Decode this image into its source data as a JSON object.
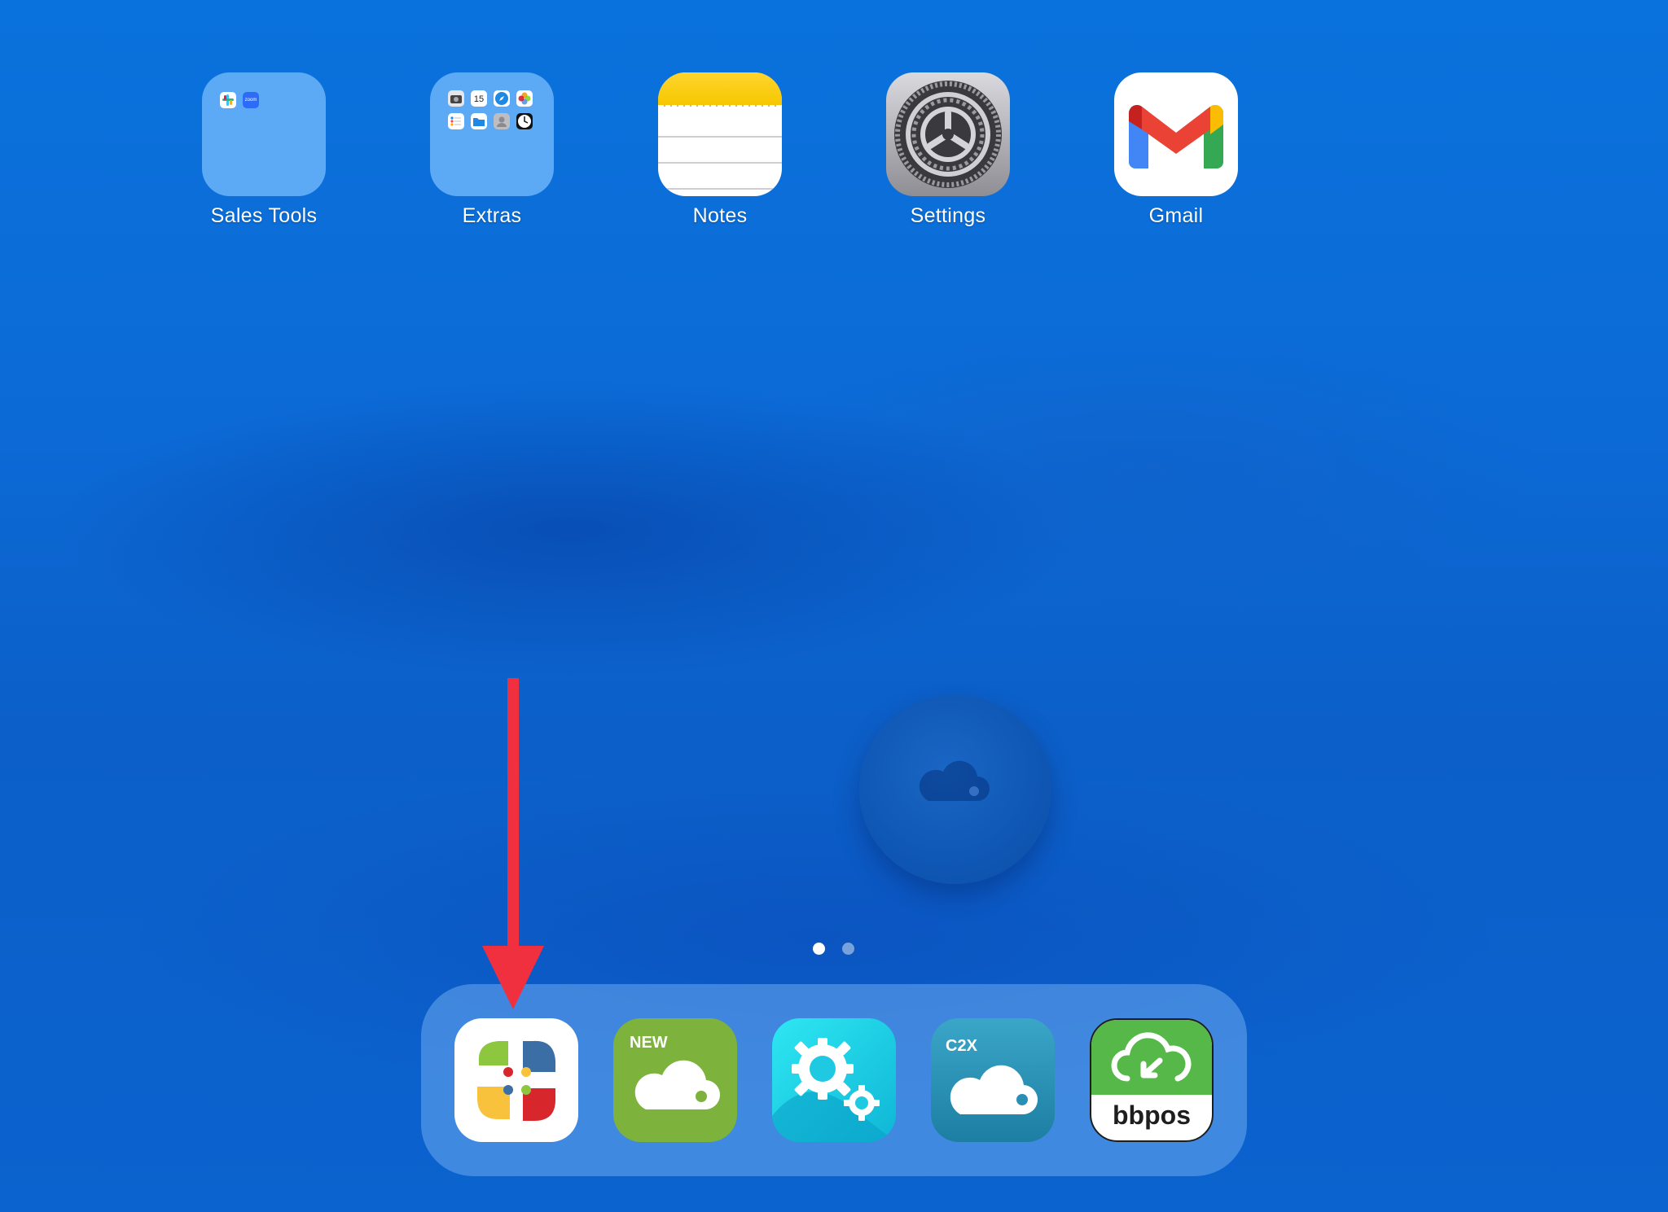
{
  "home_apps": [
    {
      "label": "Sales Tools",
      "icon": "folder-icon",
      "mini_apps": [
        "slack-icon",
        "zoom-icon"
      ]
    },
    {
      "label": "Extras",
      "icon": "folder-icon",
      "mini_apps": [
        "camera-icon",
        "calendar-icon",
        "safari-icon",
        "photos-icon",
        "reminders-icon",
        "files-icon",
        "contacts-icon",
        "clock-icon"
      ],
      "calendar_day": "15"
    },
    {
      "label": "Notes",
      "icon": "notes-icon"
    },
    {
      "label": "Settings",
      "icon": "gear-icon"
    },
    {
      "label": "Gmail",
      "icon": "gmail-icon"
    }
  ],
  "zoom_mini_label": "zoom",
  "page_indicator": {
    "pages": 2,
    "current": 1
  },
  "dock_apps": [
    {
      "icon": "tiles-app-icon"
    },
    {
      "icon": "cloud-app-icon",
      "badge_text": "NEW"
    },
    {
      "icon": "gears-app-icon"
    },
    {
      "icon": "cloud-app-icon",
      "badge_text": "C2X"
    },
    {
      "icon": "bbpos-cloud-icon",
      "brand_text": "bbpos"
    }
  ],
  "annotation": {
    "type": "arrow",
    "color": "#f0303f",
    "points_to": "dock app 1"
  },
  "colors": {
    "label": "#ffffff",
    "dock": "#6eaaf0",
    "green_app": "#7db23c",
    "teal_app": "#1fd4e0",
    "c2x_app": "#2c93b8",
    "bbpos_green": "#55b848"
  }
}
